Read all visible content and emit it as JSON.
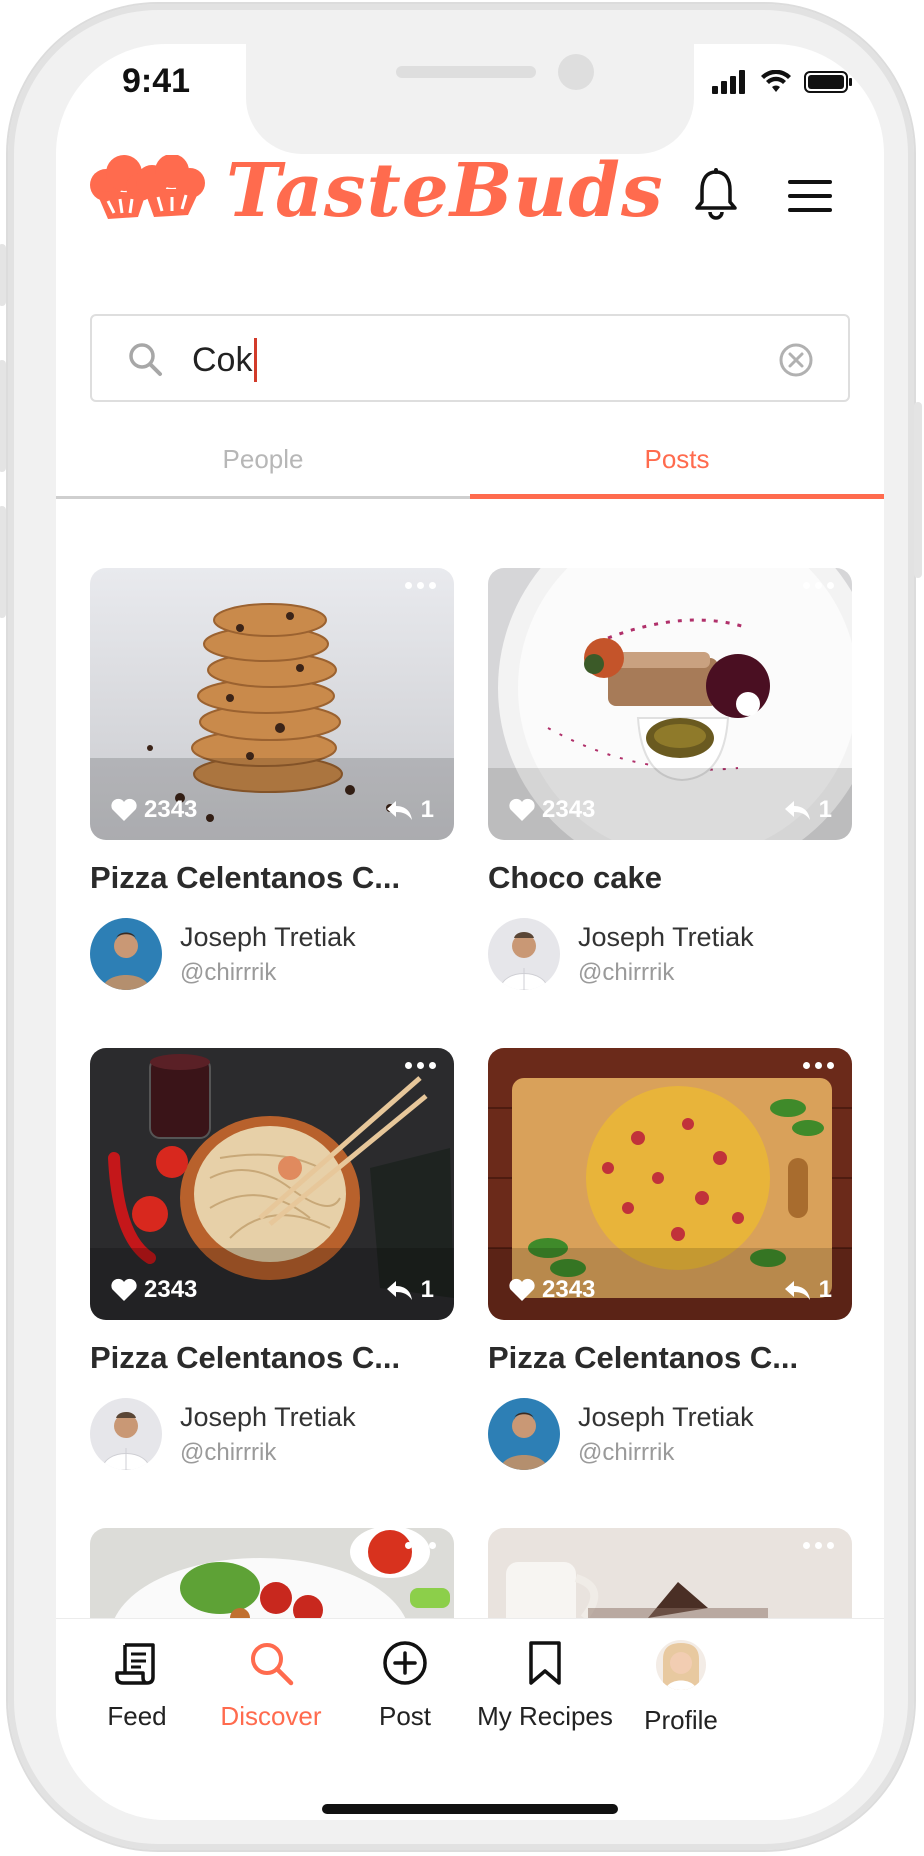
{
  "status_bar": {
    "time": "9:41"
  },
  "header": {
    "app_name": "TasteBuds"
  },
  "search": {
    "value": "Cok"
  },
  "tabs": [
    {
      "label": "People",
      "active": false
    },
    {
      "label": "Posts",
      "active": true
    }
  ],
  "posts": [
    {
      "title": "Pizza Celentanos C...",
      "likes": "2343",
      "shares": "1",
      "author_name": "Joseph Tretiak",
      "author_handle": "@chirrrik"
    },
    {
      "title": "Choco cake",
      "likes": "2343",
      "shares": "1",
      "author_name": "Joseph Tretiak",
      "author_handle": "@chirrrik"
    },
    {
      "title": "Pizza Celentanos C...",
      "likes": "2343",
      "shares": "1",
      "author_name": "Joseph Tretiak",
      "author_handle": "@chirrrik"
    },
    {
      "title": "Pizza Celentanos C...",
      "likes": "2343",
      "shares": "1",
      "author_name": "Joseph Tretiak",
      "author_handle": "@chirrrik"
    }
  ],
  "bottom_nav": [
    {
      "label": "Feed",
      "icon": "feed-icon",
      "active": false
    },
    {
      "label": "Discover",
      "icon": "search-icon",
      "active": true
    },
    {
      "label": "Post",
      "icon": "plus-circle-icon",
      "active": false
    },
    {
      "label": "My Recipes",
      "icon": "bookmark-icon",
      "active": false
    },
    {
      "label": "Profile",
      "icon": "profile-avatar",
      "active": false
    }
  ],
  "colors": {
    "accent": "#ff6b4e",
    "text": "#2b2b2b",
    "muted": "#9a9a9a"
  }
}
